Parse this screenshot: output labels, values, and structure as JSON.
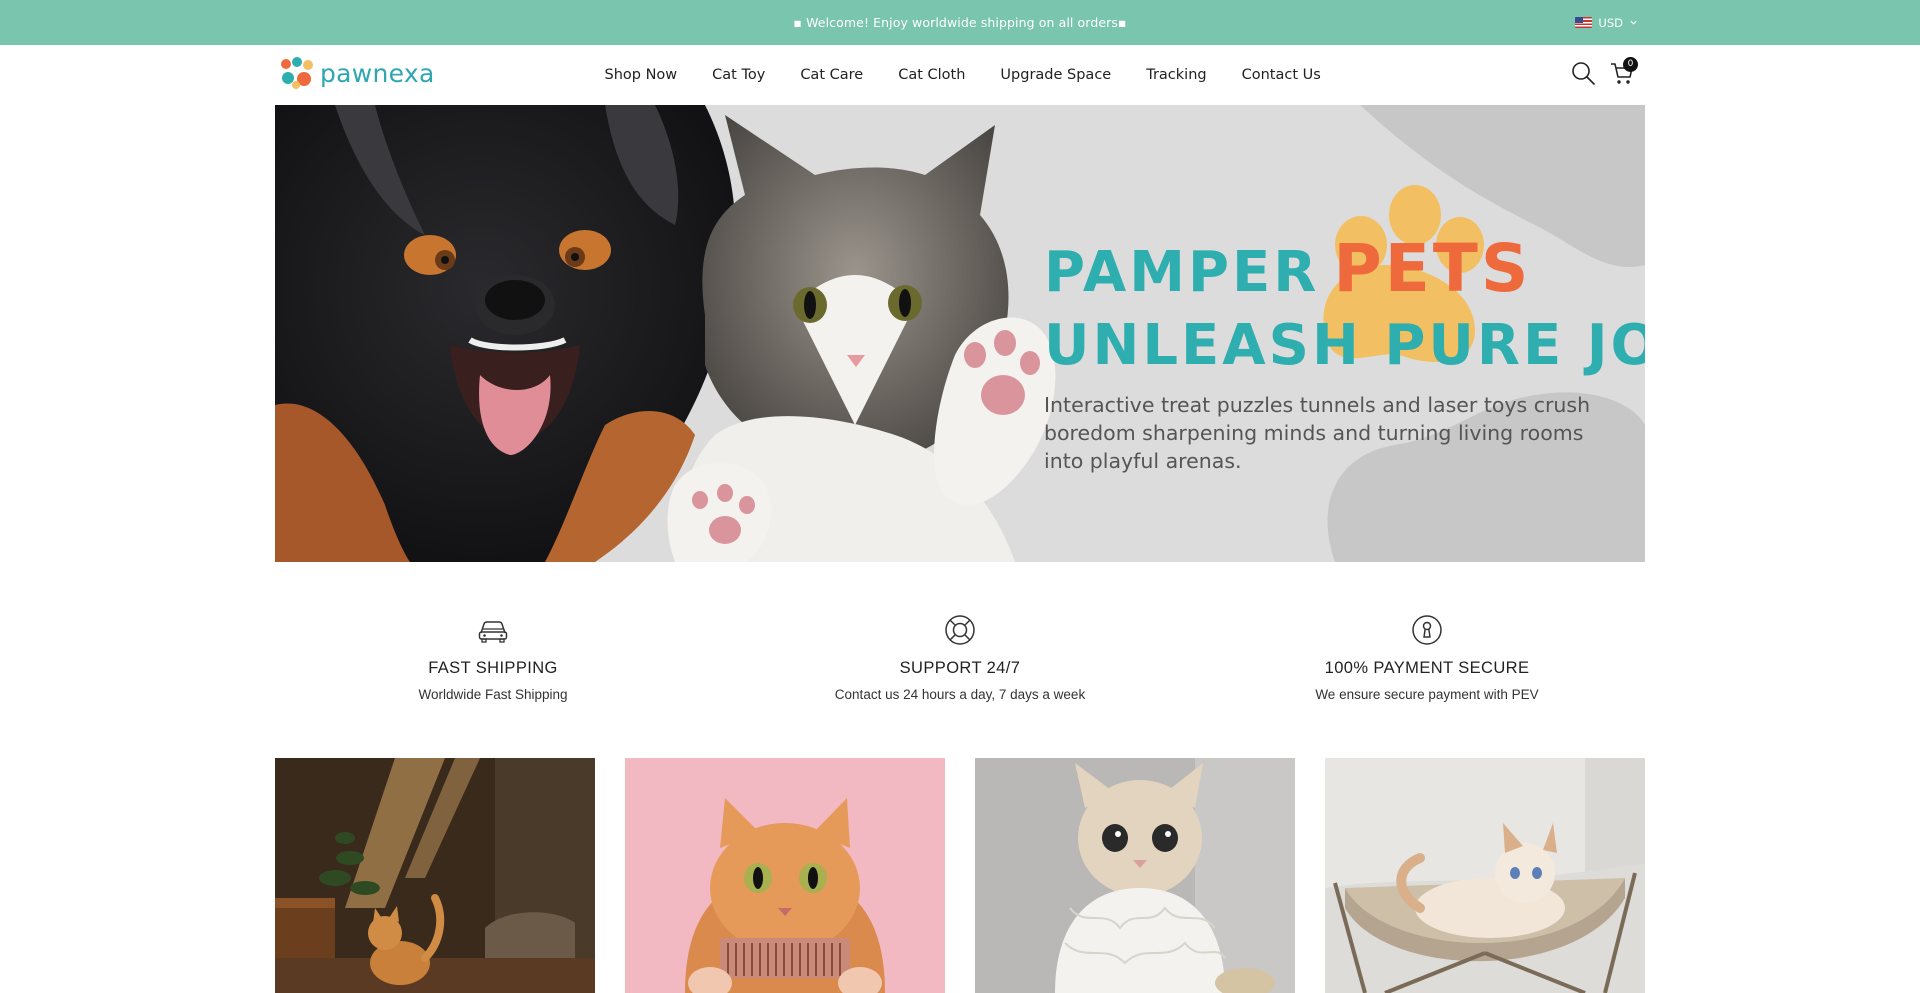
{
  "announcement": {
    "text": "▪ Welcome! Enjoy worldwide shipping on all orders▪",
    "currency": "USD",
    "currency_flag_icon": "us-flag-icon"
  },
  "header": {
    "logo_text": "pawnexa",
    "nav": [
      "Shop Now",
      "Cat Toy",
      "Cat Care",
      "Cat Cloth",
      "Upgrade Space",
      "Tracking",
      "Contact Us"
    ],
    "cart_count": "0",
    "icons": [
      "search-icon",
      "cart-icon"
    ]
  },
  "hero": {
    "headline_word1": "PAMPER",
    "headline_word2": "PETS",
    "headline_line2": "UNLEASH PURE JOY",
    "subtext": "Interactive treat puzzles tunnels and laser toys crush boredom sharpening minds and turning living rooms into playful arenas.",
    "colors": {
      "teal": "#2faeb0",
      "orange": "#ee6a3c",
      "paw": "#f2c063",
      "background": "#dcdcdc"
    }
  },
  "features": [
    {
      "icon": "car-icon",
      "title": "FAST SHIPPING",
      "description": "Worldwide Fast Shipping"
    },
    {
      "icon": "lifebuoy-icon",
      "title": "SUPPORT 24/7",
      "description": "Contact us 24 hours a day, 7 days a week"
    },
    {
      "icon": "lock-icon",
      "title": "100% PAYMENT SECURE",
      "description": "We ensure secure payment with PEV"
    }
  ],
  "brand_colors": {
    "announcement_bg": "#7ac5ae",
    "text": "#222222"
  },
  "product_tiles": [
    {
      "image": "orange cat walking in sunlit room"
    },
    {
      "image": "fluffy ginger cat with comb on pink background"
    },
    {
      "image": "cream cat wearing white lace collar"
    },
    {
      "image": "cat lounging in hammock bed"
    }
  ]
}
